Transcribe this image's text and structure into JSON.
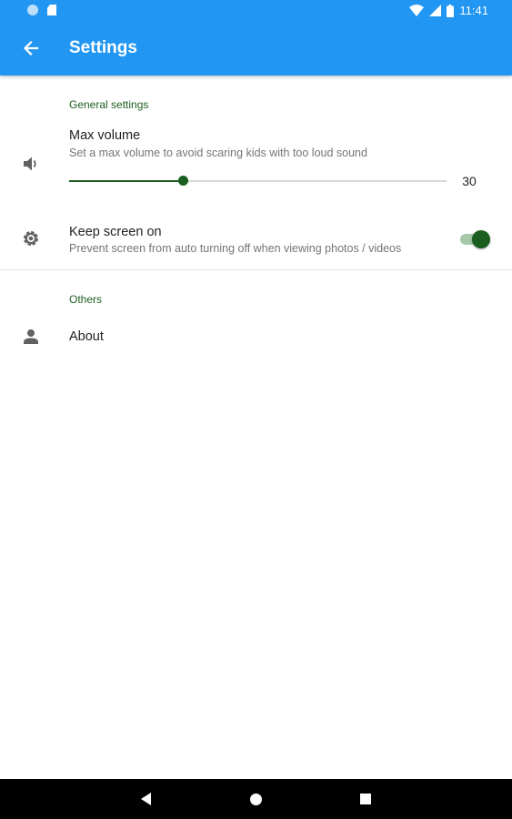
{
  "status_bar": {
    "time": "11:41"
  },
  "app_bar": {
    "title": "Settings"
  },
  "general_section": {
    "header": "General settings",
    "max_volume": {
      "title": "Max volume",
      "summary": "Set a max volume to avoid scaring kids with too loud sound",
      "value": "30",
      "fraction": 0.3,
      "icon": "volume-icon"
    },
    "keep_screen_on": {
      "title": "Keep screen on",
      "summary": "Prevent screen from auto turning off when viewing photos / videos",
      "enabled": true,
      "icon": "gear-icon"
    }
  },
  "others_section": {
    "header": "Others",
    "about": {
      "title": "About",
      "icon": "person-icon"
    }
  },
  "colors": {
    "primary": "#2196F3",
    "accent": "#1b5e20"
  }
}
